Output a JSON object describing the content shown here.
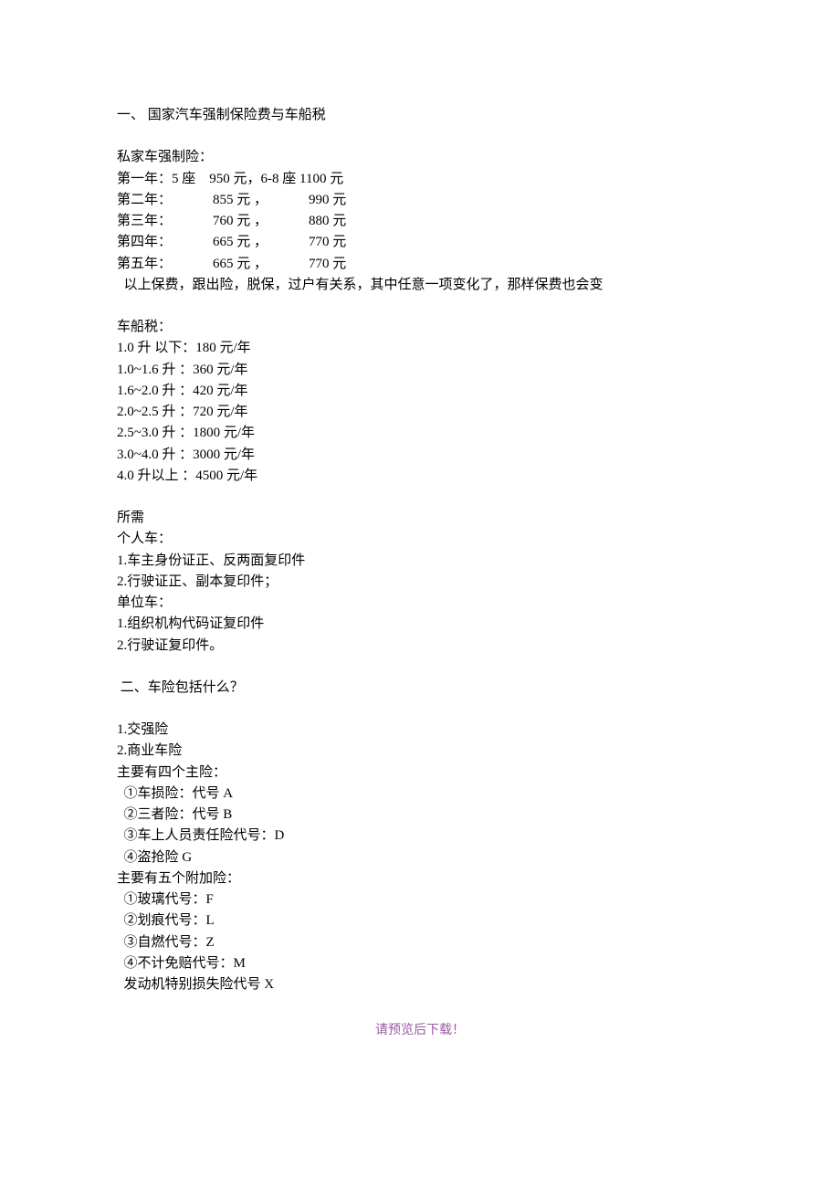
{
  "section1": {
    "title": "一、 国家汽车强制保险费与车船税",
    "compulsory": {
      "heading": "私家车强制险：",
      "rows": [
        "第一年：5 座    950 元，6-8 座 1100 元",
        "第二年：            855 元 ，            990 元",
        "第三年：            760 元 ，            880 元",
        "第四年：            665 元 ，            770 元",
        "第五年：            665 元 ，            770 元"
      ],
      "note": "  以上保费，跟出险，脱保，过户有关系，其中任意一项变化了，那样保费也会变"
    },
    "tax": {
      "heading": "车船税：",
      "rows": [
        "1.0 升 以下：180 元/年",
        "1.0~1.6 升 ：360 元/年",
        "1.6~2.0 升 ：420 元/年",
        "2.0~2.5 升 ：720 元/年",
        "2.5~3.0 升 ：1800 元/年",
        "3.0~4.0 升 ：3000 元/年",
        "4.0 升以上 ：4500 元/年"
      ]
    },
    "req": {
      "heading": "所需",
      "personal_h": "个人车：",
      "personal": [
        "1.车主身份证正、反两面复印件",
        "2.行驶证正、副本复印件；"
      ],
      "unit_h": "单位车：",
      "unit": [
        "1.组织机构代码证复印件",
        "2.行驶证复印件。"
      ]
    }
  },
  "section2": {
    "title": " 二、车险包括什么？",
    "items": [
      "1.交强险",
      "2.商业车险"
    ],
    "main_h": "主要有四个主险：",
    "main": [
      "  ①车损险：代号 A",
      "  ②三者险：代号 B",
      "  ③车上人员责任险代号：D",
      "  ④盗抢险 G"
    ],
    "addon_h": "主要有五个附加险：",
    "addon": [
      "  ①玻璃代号：F",
      "  ②划痕代号：L",
      "  ③自燃代号：Z",
      "  ④不计免赔代号：M",
      "  发动机特别损失险代号 X"
    ]
  },
  "footer": "请预览后下载！"
}
